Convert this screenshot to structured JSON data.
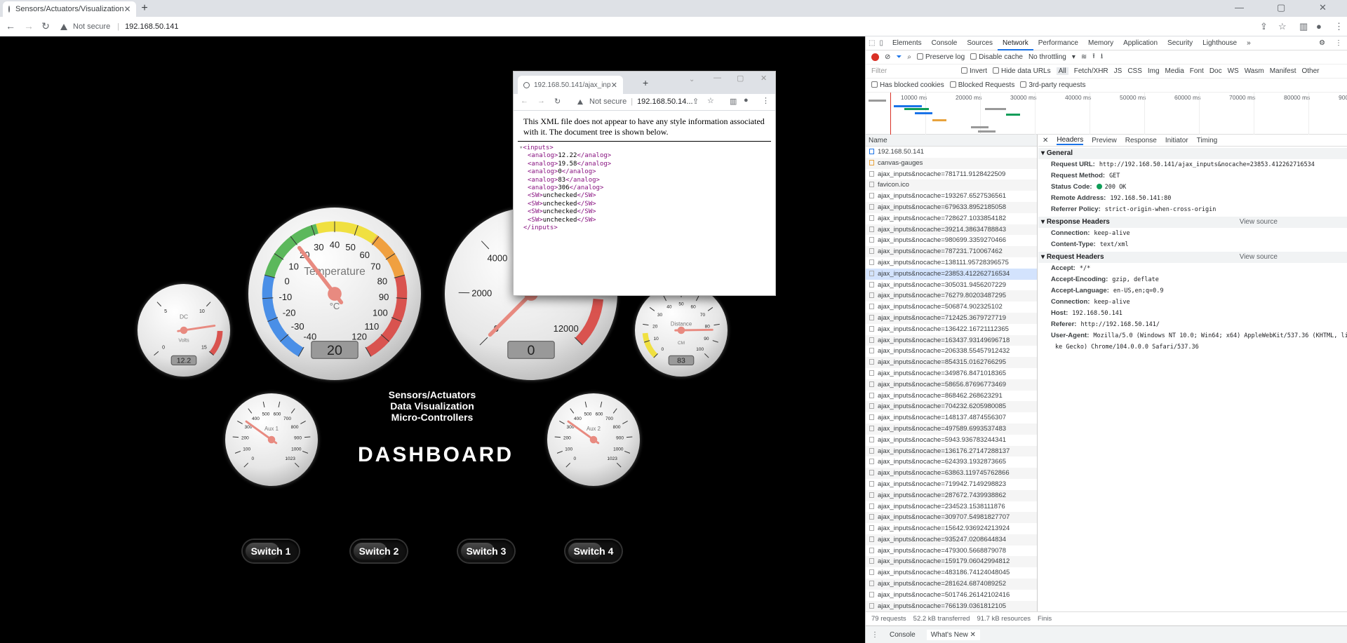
{
  "browser": {
    "tab_title": "Sensors/Actuators/Visualization",
    "not_secure": "Not secure",
    "url": "192.168.50.141"
  },
  "popup": {
    "tab_title": "192.168.50.141/ajax_inputs&r",
    "not_secure": "Not secure",
    "url": "192.168.50.14...",
    "message": "This XML file does not appear to have any style information associated with it. The document tree is shown below.",
    "xml": {
      "root": "inputs",
      "analog": [
        "12.22",
        "19.58",
        "0",
        "83",
        "306"
      ],
      "sw": [
        "unchecked",
        "unchecked",
        "unchecked",
        "unchecked"
      ]
    }
  },
  "dashboard": {
    "lines": [
      "Sensors/Actuators",
      "Data Visualization",
      "Micro-Controllers"
    ],
    "title": "DASHBOARD",
    "switches": [
      "Switch 1",
      "Switch 2",
      "Switch 3",
      "Switch 4"
    ],
    "gauges": {
      "volts": {
        "title": "DC",
        "units": "Volts",
        "value": "12.2",
        "ticks": [
          "0",
          "5",
          "10",
          "15"
        ],
        "level": 12.2
      },
      "temperature": {
        "title": "Temperature",
        "units": "°C",
        "value": "20",
        "ticks": [
          "-40",
          "-30",
          "-20",
          "-10",
          "0",
          "10",
          "20",
          "30",
          "40",
          "50",
          "60",
          "70",
          "80",
          "90",
          "100",
          "110",
          "120"
        ],
        "level": 20
      },
      "rpm": {
        "value": "0",
        "ticks": [
          "0",
          "2000",
          "4000",
          "12000"
        ],
        "level": 0
      },
      "distance": {
        "title": "Distance",
        "units": "CM",
        "value": "83",
        "ticks": [
          "0",
          "10",
          "20",
          "30",
          "40",
          "50",
          "60",
          "70",
          "80",
          "90",
          "100"
        ],
        "level": 83
      },
      "aux1": {
        "title": "Aux 1",
        "value": "1023",
        "ticks": [
          "0",
          "100",
          "200",
          "300",
          "400",
          "500",
          "600",
          "700",
          "800",
          "900",
          "1000",
          "1023"
        ],
        "level": 306
      },
      "aux2": {
        "title": "Aux 2",
        "value": "1023",
        "ticks": [
          "0",
          "100",
          "200",
          "300",
          "400",
          "500",
          "600",
          "700",
          "800",
          "900",
          "1000",
          "1023"
        ],
        "level": 306
      }
    }
  },
  "devtools": {
    "tabs": [
      "Elements",
      "Console",
      "Sources",
      "Network",
      "Performance",
      "Memory",
      "Application",
      "Security",
      "Lighthouse"
    ],
    "preserve_log": "Preserve log",
    "disable_cache": "Disable cache",
    "throttling": "No throttling",
    "filter_placeholder": "Filter",
    "invert": "Invert",
    "hide_data_urls": "Hide data URLs",
    "types": [
      "All",
      "Fetch/XHR",
      "JS",
      "CSS",
      "Img",
      "Media",
      "Font",
      "Doc",
      "WS",
      "Wasm",
      "Manifest",
      "Other"
    ],
    "has_blocked": "Has blocked cookies",
    "blocked_requests": "Blocked Requests",
    "third_party": "3rd-party requests",
    "timeline_ticks": [
      "10000 ms",
      "20000 ms",
      "30000 ms",
      "40000 ms",
      "50000 ms",
      "60000 ms",
      "70000 ms",
      "80000 ms",
      "900"
    ],
    "name_header": "Name",
    "requests": [
      "192.168.50.141",
      "canvas-gauges",
      "ajax_inputs&nocache=781711.9128422509",
      "favicon.ico",
      "ajax_inputs&nocache=193267.6527536561",
      "ajax_inputs&nocache=679633.8952185058",
      "ajax_inputs&nocache=728627.1033854182",
      "ajax_inputs&nocache=39214.38634788843",
      "ajax_inputs&nocache=980699.3359270466",
      "ajax_inputs&nocache=787231.710067462",
      "ajax_inputs&nocache=138111.95728396575",
      "ajax_inputs&nocache=23853.412262716534",
      "ajax_inputs&nocache=305031.9456207229",
      "ajax_inputs&nocache=76279.80203487295",
      "ajax_inputs&nocache=506874.902325102",
      "ajax_inputs&nocache=712425.3679727719",
      "ajax_inputs&nocache=136422.16721112365",
      "ajax_inputs&nocache=163437.93149696718",
      "ajax_inputs&nocache=206338.55457912432",
      "ajax_inputs&nocache=854315.0162766295",
      "ajax_inputs&nocache=349876.8471018365",
      "ajax_inputs&nocache=58656.87696773469",
      "ajax_inputs&nocache=868462.268623291",
      "ajax_inputs&nocache=704232.6205980085",
      "ajax_inputs&nocache=148137.4874556307",
      "ajax_inputs&nocache=497589.6993537483",
      "ajax_inputs&nocache=5943.936783244341",
      "ajax_inputs&nocache=136176.27147288137",
      "ajax_inputs&nocache=624393.1932873665",
      "ajax_inputs&nocache=63863.119745762866",
      "ajax_inputs&nocache=719942.7149298823",
      "ajax_inputs&nocache=287672.7439938862",
      "ajax_inputs&nocache=234523.1538111876",
      "ajax_inputs&nocache=309707.54981827707",
      "ajax_inputs&nocache=15642.936924213924",
      "ajax_inputs&nocache=935247.0208644834",
      "ajax_inputs&nocache=479300.5668879078",
      "ajax_inputs&nocache=159179.06042994812",
      "ajax_inputs&nocache=483186.74124048045",
      "ajax_inputs&nocache=281624.6874089252",
      "ajax_inputs&nocache=501746.26142102416",
      "ajax_inputs&nocache=766139.0361812105"
    ],
    "detail_tabs": [
      "Headers",
      "Preview",
      "Response",
      "Initiator",
      "Timing"
    ],
    "general_label": "General",
    "general": [
      [
        "Request URL:",
        "http://192.168.50.141/ajax_inputs&nocache=23853.412262716534"
      ],
      [
        "Request Method:",
        "GET"
      ],
      [
        "Status Code:",
        "200 OK"
      ],
      [
        "Remote Address:",
        "192.168.50.141:80"
      ],
      [
        "Referrer Policy:",
        "strict-origin-when-cross-origin"
      ]
    ],
    "response_headers_label": "Response Headers",
    "view_source": "View source",
    "response_headers": [
      [
        "Connection:",
        "keep-alive"
      ],
      [
        "Content-Type:",
        "text/xml"
      ]
    ],
    "request_headers_label": "Request Headers",
    "request_headers": [
      [
        "Accept:",
        "*/*"
      ],
      [
        "Accept-Encoding:",
        "gzip, deflate"
      ],
      [
        "Accept-Language:",
        "en-US,en;q=0.9"
      ],
      [
        "Connection:",
        "keep-alive"
      ],
      [
        "Host:",
        "192.168.50.141"
      ],
      [
        "Referer:",
        "http://192.168.50.141/"
      ],
      [
        "User-Agent:",
        "Mozilla/5.0 (Windows NT 10.0; Win64; x64) AppleWebKit/537.36 (KHTML, li"
      ],
      [
        "",
        "ke Gecko) Chrome/104.0.0.0 Safari/537.36"
      ]
    ],
    "status": [
      "79 requests",
      "52.2 kB transferred",
      "91.7 kB resources",
      "Finis"
    ],
    "drawer": [
      "Console",
      "What's New"
    ]
  }
}
